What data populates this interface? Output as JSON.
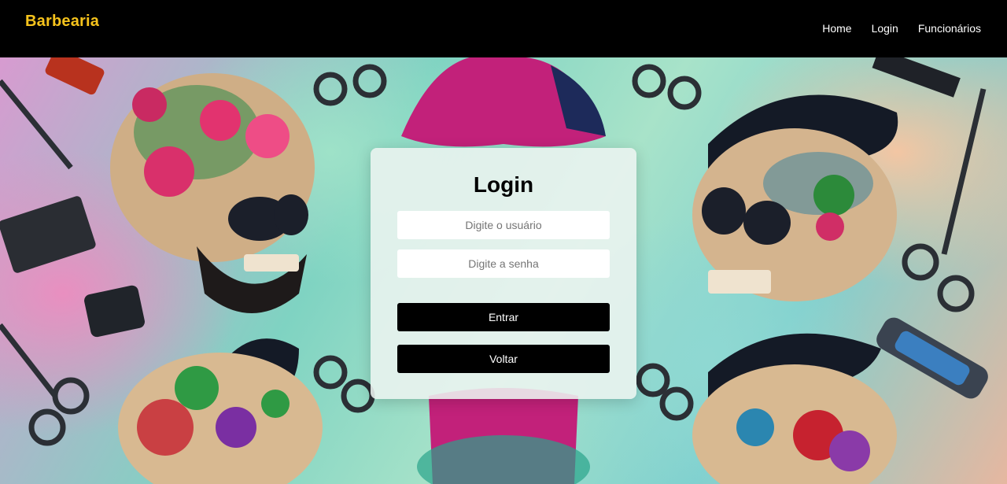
{
  "navbar": {
    "brand": "Barbearia",
    "links": [
      {
        "label": "Home"
      },
      {
        "label": "Login"
      },
      {
        "label": "Funcionários"
      }
    ],
    "brand_color": "#f6c31c"
  },
  "login": {
    "title": "Login",
    "username_placeholder": "Digite o usuário",
    "password_placeholder": "Digite a senha",
    "submit_label": "Entrar",
    "back_label": "Voltar"
  },
  "background": {
    "description_icon": "tattooed-skull-barber-illustration"
  }
}
